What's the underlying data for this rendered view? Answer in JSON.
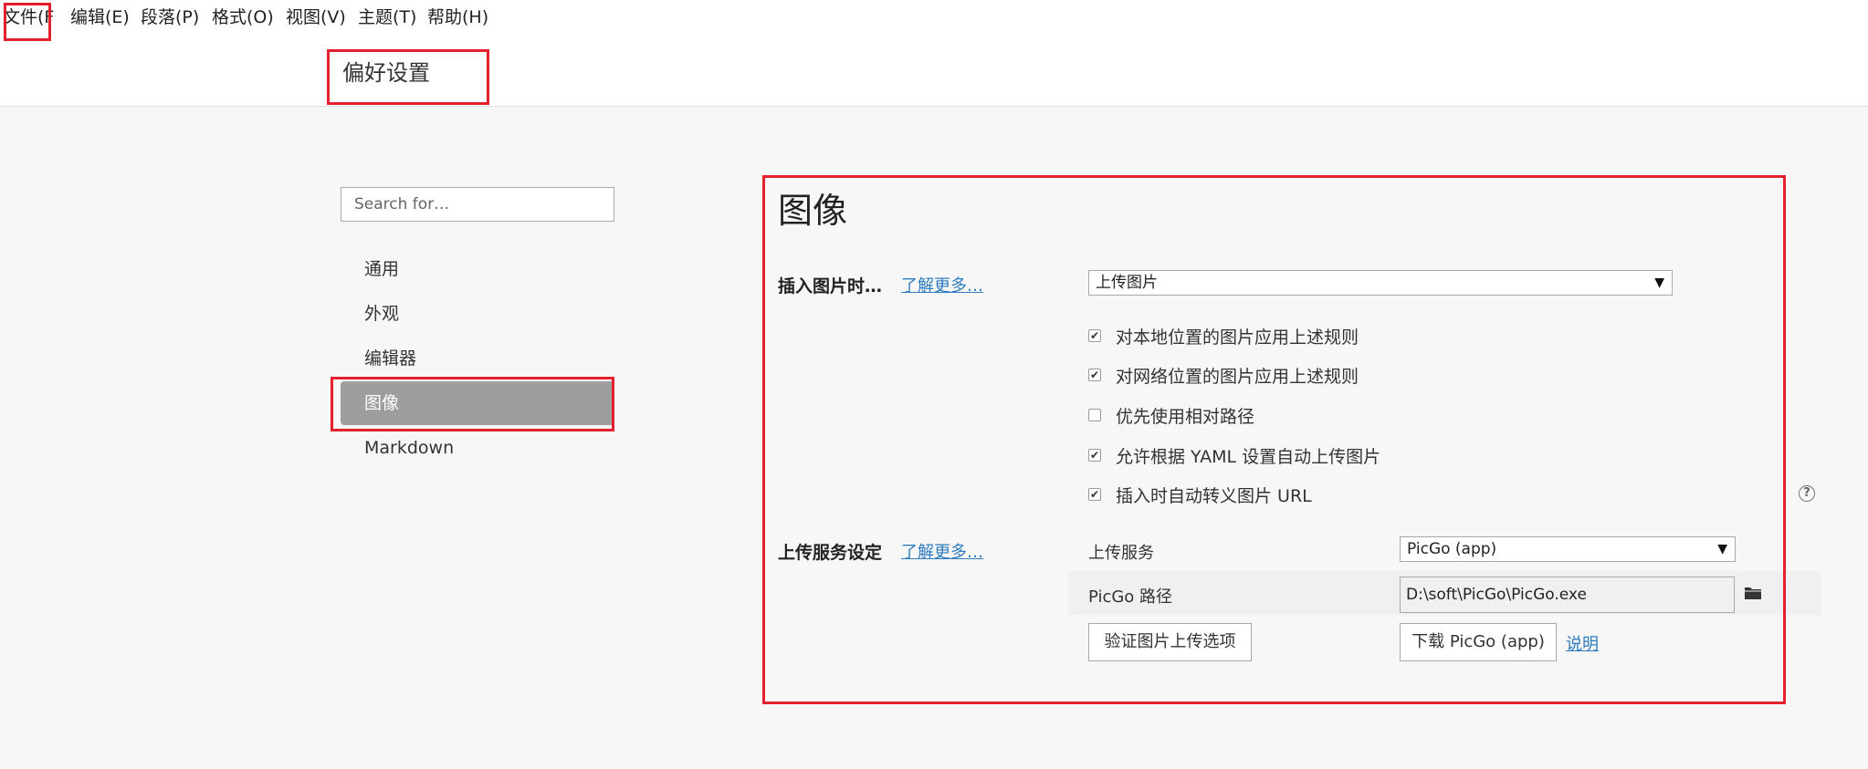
{
  "menu": {
    "file": "文件(F",
    "edit": "编辑(E)",
    "paragraph": "段落(P)",
    "format": "格式(O)",
    "view": "视图(V)",
    "theme": "主题(T)",
    "help": "帮助(H)"
  },
  "header": {
    "title": "偏好设置"
  },
  "search": {
    "placeholder": "Search for…"
  },
  "sidebar": {
    "items": [
      {
        "label": "通用"
      },
      {
        "label": "外观"
      },
      {
        "label": "编辑器"
      },
      {
        "label": "图像"
      },
      {
        "label": "Markdown"
      }
    ],
    "active_index": 3
  },
  "main": {
    "title": "图像",
    "insert": {
      "label": "插入图片时…",
      "learn_more": "了解更多…",
      "select_value": "上传图片"
    },
    "checks": [
      {
        "label": "对本地位置的图片应用上述规则",
        "checked": true
      },
      {
        "label": "对网络位置的图片应用上述规则",
        "checked": true
      },
      {
        "label": "优先使用相对路径",
        "checked": false
      },
      {
        "label": "允许根据 YAML 设置自动上传图片",
        "checked": true
      },
      {
        "label": "插入时自动转义图片 URL",
        "checked": true
      }
    ],
    "upload": {
      "label": "上传服务设定",
      "learn_more": "了解更多…",
      "service_label": "上传服务",
      "service_value": "PicGo (app)",
      "path_label": "PicGo 路径",
      "path_value": "D:\\soft\\PicGo\\PicGo.exe",
      "verify_button": "验证图片上传选项",
      "download_button": "下载 PicGo (app)",
      "explain_link": "说明"
    }
  },
  "icons": {
    "help": "?",
    "dropdown": "▼",
    "check": "✔"
  },
  "colors": {
    "highlight_border": "#e5202e",
    "active_nav": "#9e9e9e",
    "link": "#2f7bbf"
  }
}
